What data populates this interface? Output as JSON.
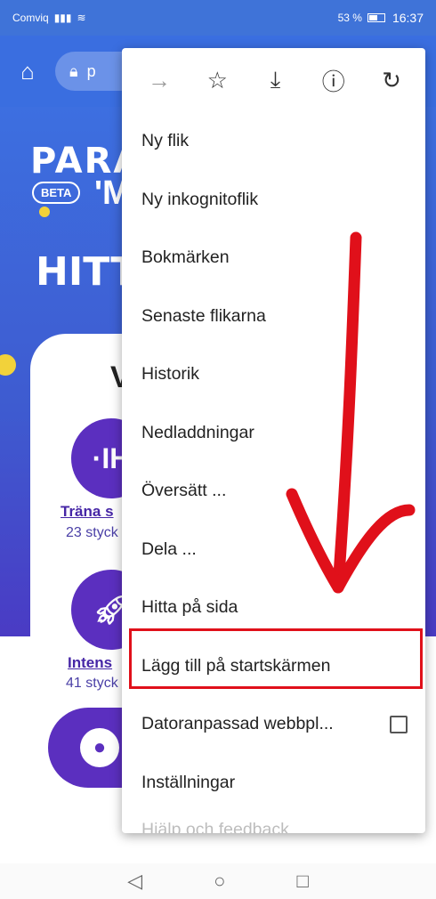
{
  "status_bar": {
    "carrier": "Comviq",
    "battery": "53 %",
    "time": "16:37"
  },
  "toolbar": {
    "url_partial": "p"
  },
  "page": {
    "logo_top": "PARA",
    "logo_beta": "BETA",
    "logo_bottom": "'M",
    "hero": "HITT",
    "card_title": "V",
    "items": [
      {
        "link": "Träna s",
        "count": "23 styck"
      },
      {
        "link": "Intens",
        "count": "41 styck"
      }
    ]
  },
  "menu": {
    "toolbar_icons": [
      "forward-icon",
      "star-icon",
      "download-icon",
      "info-icon",
      "refresh-icon"
    ],
    "items": [
      "Ny flik",
      "Ny inkognitoflik",
      "Bokmärken",
      "Senaste flikarna",
      "Historik",
      "Nedladdningar",
      "Översätt ...",
      "Dela ...",
      "Hitta på sida",
      "Lägg till på startskärmen",
      "Datoranpassad webbpl...",
      "Inställningar",
      "Hjälp och feedback"
    ],
    "highlighted_item": "Lägg till på startskärmen"
  },
  "colors": {
    "accent": "#3a6ee0",
    "purple": "#5b2fbf",
    "annotation": "#e0101a"
  }
}
